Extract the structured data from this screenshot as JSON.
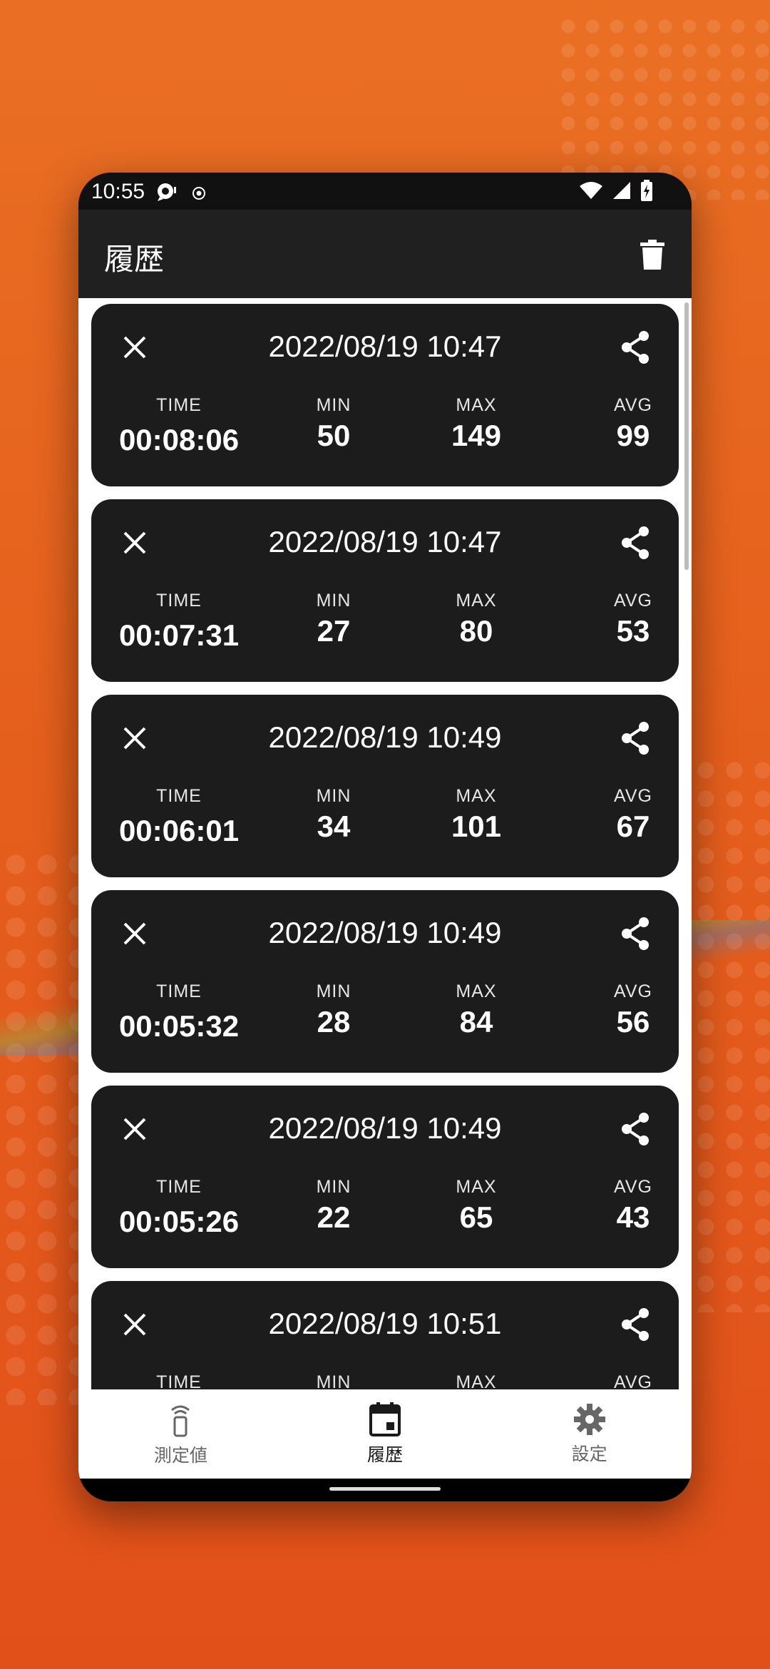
{
  "status_bar": {
    "time": "10:55"
  },
  "app_bar": {
    "title": "履歴"
  },
  "history": [
    {
      "date": "2022/08/19 10:47",
      "time_label": "TIME",
      "time": "00:08:06",
      "min_label": "MIN",
      "min": "50",
      "max_label": "MAX",
      "max": "149",
      "avg_label": "AVG",
      "avg": "99"
    },
    {
      "date": "2022/08/19 10:47",
      "time_label": "TIME",
      "time": "00:07:31",
      "min_label": "MIN",
      "min": "27",
      "max_label": "MAX",
      "max": "80",
      "avg_label": "AVG",
      "avg": "53"
    },
    {
      "date": "2022/08/19 10:49",
      "time_label": "TIME",
      "time": "00:06:01",
      "min_label": "MIN",
      "min": "34",
      "max_label": "MAX",
      "max": "101",
      "avg_label": "AVG",
      "avg": "67"
    },
    {
      "date": "2022/08/19 10:49",
      "time_label": "TIME",
      "time": "00:05:32",
      "min_label": "MIN",
      "min": "28",
      "max_label": "MAX",
      "max": "84",
      "avg_label": "AVG",
      "avg": "56"
    },
    {
      "date": "2022/08/19 10:49",
      "time_label": "TIME",
      "time": "00:05:26",
      "min_label": "MIN",
      "min": "22",
      "max_label": "MAX",
      "max": "65",
      "avg_label": "AVG",
      "avg": "43"
    },
    {
      "date": "2022/08/19 10:51",
      "time_label": "TIME",
      "time": "",
      "min_label": "MIN",
      "min": "",
      "max_label": "MAX",
      "max": "",
      "avg_label": "AVG",
      "avg": ""
    }
  ],
  "bottom_nav": {
    "items": [
      {
        "label": "測定値",
        "icon": "signal-device-icon",
        "active": false
      },
      {
        "label": "履歴",
        "icon": "calendar-icon",
        "active": true
      },
      {
        "label": "設定",
        "icon": "gear-icon",
        "active": false
      }
    ]
  },
  "colors": {
    "background": "#e8621f",
    "card": "#1c1c1c",
    "app_bar": "#202020"
  }
}
